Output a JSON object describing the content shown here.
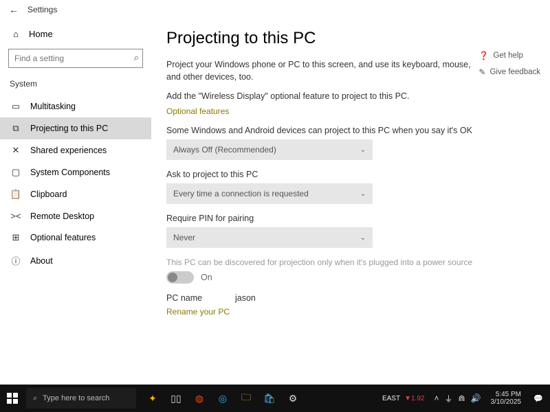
{
  "titlebar": {
    "back_icon": "←",
    "title": "Settings"
  },
  "sidebar": {
    "home_icon": "⌂",
    "home_label": "Home",
    "search_placeholder": "Find a setting",
    "search_icon": "⌕",
    "group": "System",
    "items": [
      {
        "icon": "▭",
        "label": "Multitasking"
      },
      {
        "icon": "⧉",
        "label": "Projecting to this PC",
        "selected": true
      },
      {
        "icon": "✕",
        "label": "Shared experiences"
      },
      {
        "icon": "▢",
        "label": "System Components"
      },
      {
        "icon": "📋",
        "label": "Clipboard"
      },
      {
        "icon": "><",
        "label": "Remote Desktop"
      },
      {
        "icon": "⊞",
        "label": "Optional features"
      },
      {
        "icon": "ⓘ",
        "label": "About"
      }
    ]
  },
  "main": {
    "heading": "Projecting to this PC",
    "intro": "Project your Windows phone or PC to this screen, and use its keyboard, mouse, and other devices, too.",
    "feature_note": "Add the \"Wireless Display\" optional feature to project to this PC.",
    "optional_link": "Optional features",
    "setting1_label": "Some Windows and Android devices can project to this PC when you say it's OK",
    "setting1_value": "Always Off (Recommended)",
    "setting2_label": "Ask to project to this PC",
    "setting2_value": "Every time a connection is requested",
    "setting3_label": "Require PIN for pairing",
    "setting3_value": "Never",
    "power_note": "This PC can be discovered for projection only when it's plugged into a power source",
    "toggle_text": "On",
    "pcname_key": "PC name",
    "pcname_val": "jason",
    "rename_link": "Rename your PC",
    "help": {
      "gethelp_icon": "❓",
      "gethelp": "Get help",
      "feedback_icon": "✎",
      "feedback": "Give feedback"
    }
  },
  "taskbar": {
    "search_placeholder": "Type here to search",
    "stock": {
      "name": "EAST",
      "delta": "▼1.92"
    },
    "time": "5:45 PM",
    "date": "3/10/2025"
  }
}
